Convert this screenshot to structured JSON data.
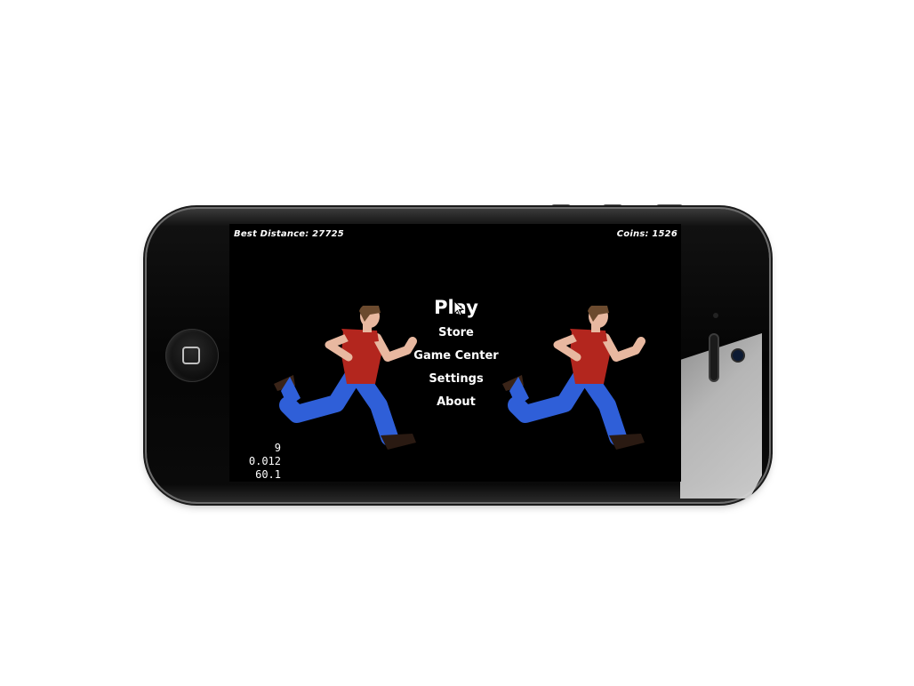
{
  "hud": {
    "best_distance": "Best Distance: 27725",
    "coins": "Coins: 1526"
  },
  "menu": {
    "play": "Play",
    "store": "Store",
    "game_center": "Game Center",
    "settings": "Settings",
    "about": "About"
  },
  "stats": {
    "line1": "9",
    "line2": "0.012",
    "line3": "60.1"
  },
  "colors": {
    "screen_bg": "#000000",
    "shirt": "#b3261e",
    "pants": "#2f5fd8",
    "skin": "#e8b8a0",
    "hair": "#6b4a2e"
  },
  "icons": {
    "home": "home-button-icon",
    "cursor": "mouse-cursor-icon",
    "runner": "running-man-sprite"
  }
}
